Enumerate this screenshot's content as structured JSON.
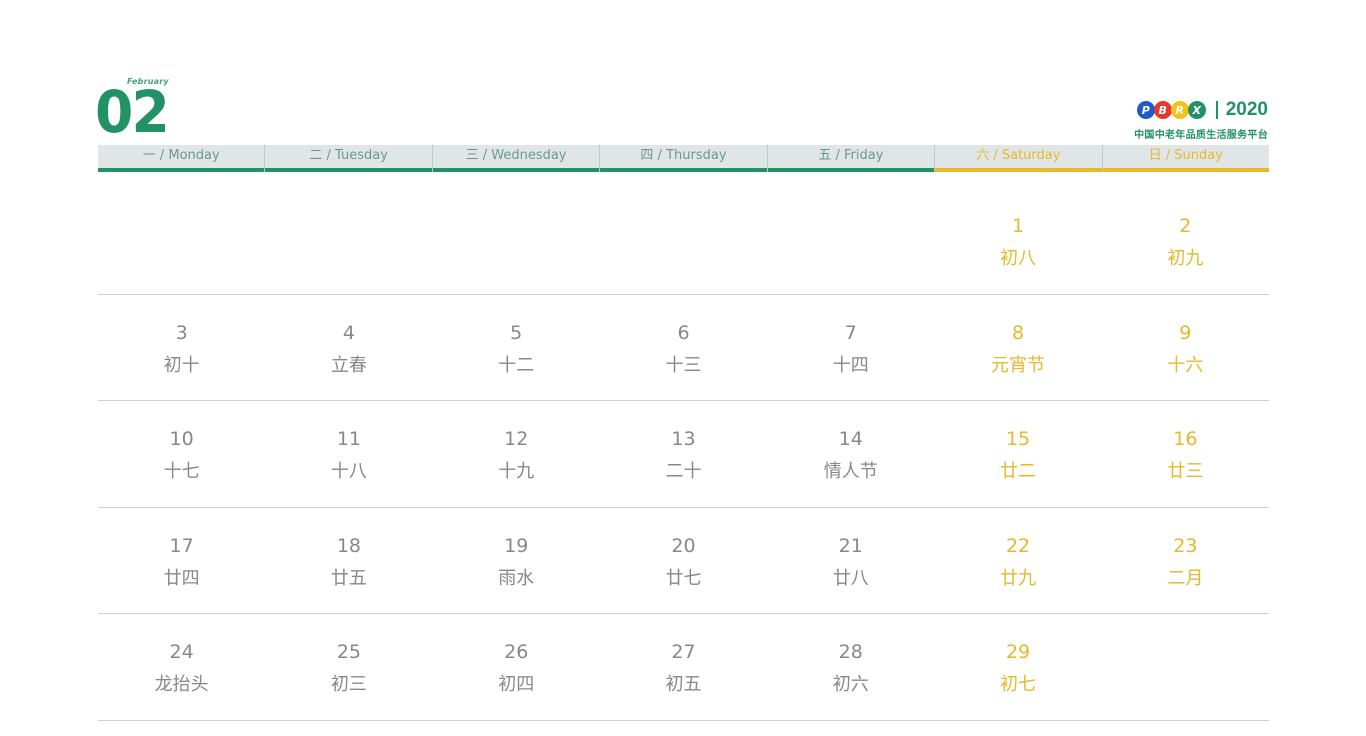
{
  "header": {
    "month_name": "February",
    "month_number": "02",
    "brand_letters": [
      "P",
      "B",
      "R",
      "X"
    ],
    "brand_colors": [
      "#1f5cc8",
      "#e33a2c",
      "#f2c318",
      "#229266"
    ],
    "year": "2020",
    "brand_subtitle": "中国中老年品质生活服务平台"
  },
  "colors": {
    "accent_green": "#229266",
    "weekend_yellow": "#e6b92b",
    "text_gray": "#888888"
  },
  "weekdays": [
    {
      "label": "一 / Monday",
      "weekend": false
    },
    {
      "label": "二 / Tuesday",
      "weekend": false
    },
    {
      "label": "三 / Wednesday",
      "weekend": false
    },
    {
      "label": "四 / Thursday",
      "weekend": false
    },
    {
      "label": "五 / Friday",
      "weekend": false
    },
    {
      "label": "六 / Saturday",
      "weekend": true
    },
    {
      "label": "日 / Sunday",
      "weekend": true
    }
  ],
  "weeks": [
    [
      null,
      null,
      null,
      null,
      null,
      {
        "day": "1",
        "lunar": "初八"
      },
      {
        "day": "2",
        "lunar": "初九"
      }
    ],
    [
      {
        "day": "3",
        "lunar": "初十"
      },
      {
        "day": "4",
        "lunar": "立春"
      },
      {
        "day": "5",
        "lunar": "十二"
      },
      {
        "day": "6",
        "lunar": "十三"
      },
      {
        "day": "7",
        "lunar": "十四"
      },
      {
        "day": "8",
        "lunar": "元宵节"
      },
      {
        "day": "9",
        "lunar": "十六"
      }
    ],
    [
      {
        "day": "10",
        "lunar": "十七"
      },
      {
        "day": "11",
        "lunar": "十八"
      },
      {
        "day": "12",
        "lunar": "十九"
      },
      {
        "day": "13",
        "lunar": "二十"
      },
      {
        "day": "14",
        "lunar": "情人节"
      },
      {
        "day": "15",
        "lunar": "廿二"
      },
      {
        "day": "16",
        "lunar": "廿三"
      }
    ],
    [
      {
        "day": "17",
        "lunar": "廿四"
      },
      {
        "day": "18",
        "lunar": "廿五"
      },
      {
        "day": "19",
        "lunar": "雨水"
      },
      {
        "day": "20",
        "lunar": "廿七"
      },
      {
        "day": "21",
        "lunar": "廿八"
      },
      {
        "day": "22",
        "lunar": "廿九"
      },
      {
        "day": "23",
        "lunar": "二月"
      }
    ],
    [
      {
        "day": "24",
        "lunar": "龙抬头"
      },
      {
        "day": "25",
        "lunar": "初三"
      },
      {
        "day": "26",
        "lunar": "初四"
      },
      {
        "day": "27",
        "lunar": "初五"
      },
      {
        "day": "28",
        "lunar": "初六"
      },
      {
        "day": "29",
        "lunar": "初七"
      },
      null
    ]
  ]
}
